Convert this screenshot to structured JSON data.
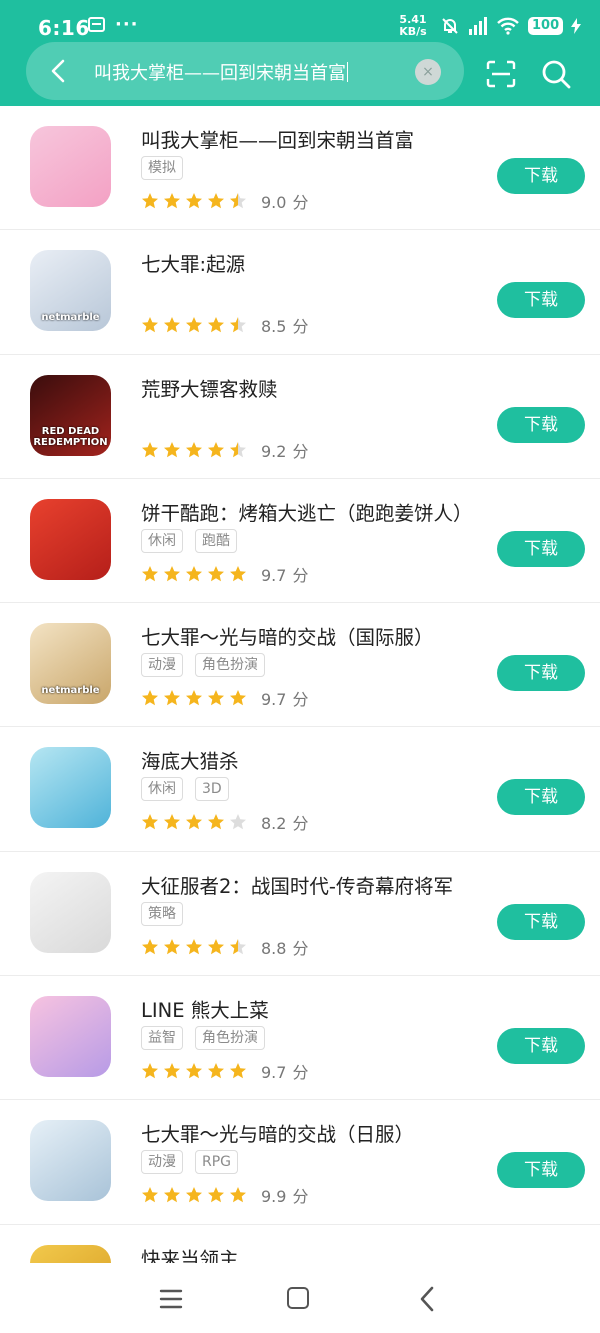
{
  "status_bar": {
    "time": "6:16",
    "more_dots": "···",
    "net_speed_value": "5.41",
    "net_speed_unit": "KB/s",
    "battery": "100"
  },
  "search": {
    "query": "叫我大掌柜——回到宋朝当首富",
    "clear_glyph": "×"
  },
  "download_label": "下载",
  "score_unit": "分",
  "apps": [
    {
      "title": "叫我大掌柜——回到宋朝当首富",
      "tags": [
        "模拟"
      ],
      "stars": 4.5,
      "score": "9.0",
      "icon": "shopkeeper-game-icon",
      "colors": [
        "#f7c6dc",
        "#f3a1c4"
      ]
    },
    {
      "title": "七大罪:起源",
      "tags": [],
      "stars": 4.5,
      "score": "8.5",
      "icon": "seven-deadly-sins-origin-icon",
      "colors": [
        "#e9eef5",
        "#b8c7d8"
      ],
      "icon_caption": "netmarble"
    },
    {
      "title": "荒野大镖客救赎",
      "tags": [],
      "stars": 4.5,
      "score": "9.2",
      "icon": "red-dead-redemption-icon",
      "colors": [
        "#3a0d0d",
        "#a2231d"
      ],
      "icon_caption": "RED DEAD REDEMPTION"
    },
    {
      "title": "饼干酷跑：烤箱大逃亡（跑跑姜饼人）",
      "tags": [
        "休闲",
        "跑酷"
      ],
      "stars": 5,
      "score": "9.7",
      "icon": "cookie-run-icon",
      "colors": [
        "#e8412e",
        "#b51f1a"
      ]
    },
    {
      "title": "七大罪～光与暗的交战（国际服）",
      "tags": [
        "动漫",
        "角色扮演"
      ],
      "stars": 5,
      "score": "9.7",
      "icon": "grand-cross-global-icon",
      "colors": [
        "#f3e3c4",
        "#c9a66a"
      ],
      "icon_caption": "netmarble"
    },
    {
      "title": "海底大猎杀",
      "tags": [
        "休闲",
        "3D"
      ],
      "stars": 4,
      "score": "8.2",
      "icon": "hungry-shark-icon",
      "colors": [
        "#b6e6f2",
        "#4fb3d9"
      ]
    },
    {
      "title": "大征服者2：战国时代-传奇幕府将军",
      "tags": [
        "策略"
      ],
      "stars": 4.5,
      "score": "8.8",
      "icon": "samurai-helmet-icon",
      "colors": [
        "#f4f4f4",
        "#d9d9d9"
      ]
    },
    {
      "title": "LINE 熊大上菜",
      "tags": [
        "益智",
        "角色扮演"
      ],
      "stars": 5,
      "score": "9.7",
      "icon": "line-chef-icon",
      "colors": [
        "#f7c3e0",
        "#b79be6"
      ]
    },
    {
      "title": "七大罪～光与暗的交战（日服）",
      "tags": [
        "动漫",
        "RPG"
      ],
      "stars": 5,
      "score": "9.9",
      "icon": "grand-cross-jp-icon",
      "colors": [
        "#e6f0f7",
        "#a9c3d8"
      ]
    },
    {
      "title": "快来当领主",
      "tags": [],
      "stars": 0,
      "score": "",
      "icon": "lord-game-icon",
      "colors": [
        "#f2c94c",
        "#d59a1f"
      ]
    }
  ],
  "colors": {
    "accent": "#1fbf9f",
    "star": "#f5b51d",
    "star_empty": "#dddddd"
  }
}
